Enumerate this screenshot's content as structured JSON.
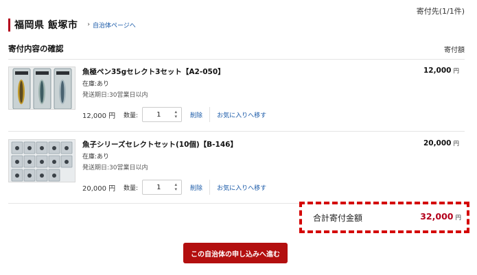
{
  "destination": {
    "label": "寄付先(1/1件)"
  },
  "header": {
    "prefecture_city": "福岡県 飯塚市",
    "municipality_link": "自治体ページへ"
  },
  "section": {
    "title": "寄付内容の確認",
    "amount_column": "寄付額"
  },
  "items": [
    {
      "name": "魚極ペン35gセレクト3セット【A2-050】",
      "stock": "在庫:あり",
      "shipping": "発送期日:30営業日以内",
      "price": "12,000",
      "unit_price": "12,000 円",
      "yen": "円",
      "qty_label": "数量:",
      "qty": "1",
      "delete": "削除",
      "favorite": "お気に入りへ移す"
    },
    {
      "name": "魚子シリーズセレクトセット(10個)【B-146】",
      "stock": "在庫:あり",
      "shipping": "発送期日:30営業日以内",
      "price": "20,000",
      "unit_price": "20,000 円",
      "yen": "円",
      "qty_label": "数量:",
      "qty": "1",
      "delete": "削除",
      "favorite": "お気に入りへ移す"
    }
  ],
  "total": {
    "label": "合計寄付金額",
    "amount": "32,000",
    "yen": "円"
  },
  "proceed_button": "この自治体の申し込みへ進む"
}
